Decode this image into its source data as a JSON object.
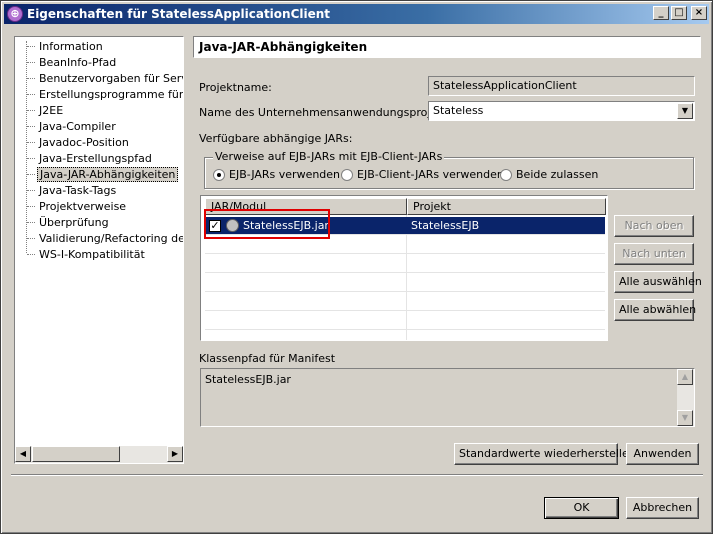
{
  "window": {
    "title": "Eigenschaften für StatelessApplicationClient",
    "minimize_label": "_",
    "maximize_label": "□",
    "close_label": "×"
  },
  "tree": {
    "items": [
      {
        "label": "Information"
      },
      {
        "label": "BeanInfo-Pfad"
      },
      {
        "label": "Benutzervorgaben für Server"
      },
      {
        "label": "Erstellungsprogramme für exte"
      },
      {
        "label": "J2EE"
      },
      {
        "label": "Java-Compiler"
      },
      {
        "label": "Javadoc-Position"
      },
      {
        "label": "Java-Erstellungspfad"
      },
      {
        "label": "Java-JAR-Abhängigkeiten",
        "selected": true
      },
      {
        "label": "Java-Task-Tags"
      },
      {
        "label": "Projektverweise"
      },
      {
        "label": "Überprüfung"
      },
      {
        "label": "Validierung/Refactoring der Lir"
      },
      {
        "label": "WS-I-Kompatibilität"
      }
    ],
    "scroll_left_icon": "◀",
    "scroll_right_icon": "▶"
  },
  "page": {
    "title": "Java-JAR-Abhängigkeiten",
    "project_name_label": "Projektname:",
    "project_name_value": "StatelessApplicationClient",
    "ear_label": "Name des Unternehmensanwendungsprojekts:",
    "ear_value": "Stateless",
    "available_jars_label": "Verfügbare abhängige JARs:",
    "group_title": "Verweise auf EJB-JARs mit EJB-Client-JARs",
    "radio_options": [
      {
        "label": "EJB-JARs verwenden",
        "checked": true
      },
      {
        "label": "EJB-Client-JARs verwenden",
        "checked": false
      },
      {
        "label": "Beide zulassen",
        "checked": false
      }
    ],
    "table": {
      "columns": [
        "JAR/Modul",
        "Projekt"
      ],
      "rows": [
        {
          "jar": "StatelessEJB.jar",
          "project": "StatelessEJB",
          "checked": true,
          "check_mark": "✓"
        }
      ]
    },
    "side_buttons": {
      "up": "Nach oben",
      "down": "Nach unten",
      "select_all": "Alle auswählen",
      "deselect_all": "Alle abwählen"
    },
    "manifest_label": "Klassenpfad für Manifest",
    "manifest_value": "StatelessEJB.jar",
    "restore_defaults": "Standardwerte wiederherstellen",
    "apply": "Anwenden"
  },
  "dialog": {
    "ok": "OK",
    "cancel": "Abbrechen"
  }
}
